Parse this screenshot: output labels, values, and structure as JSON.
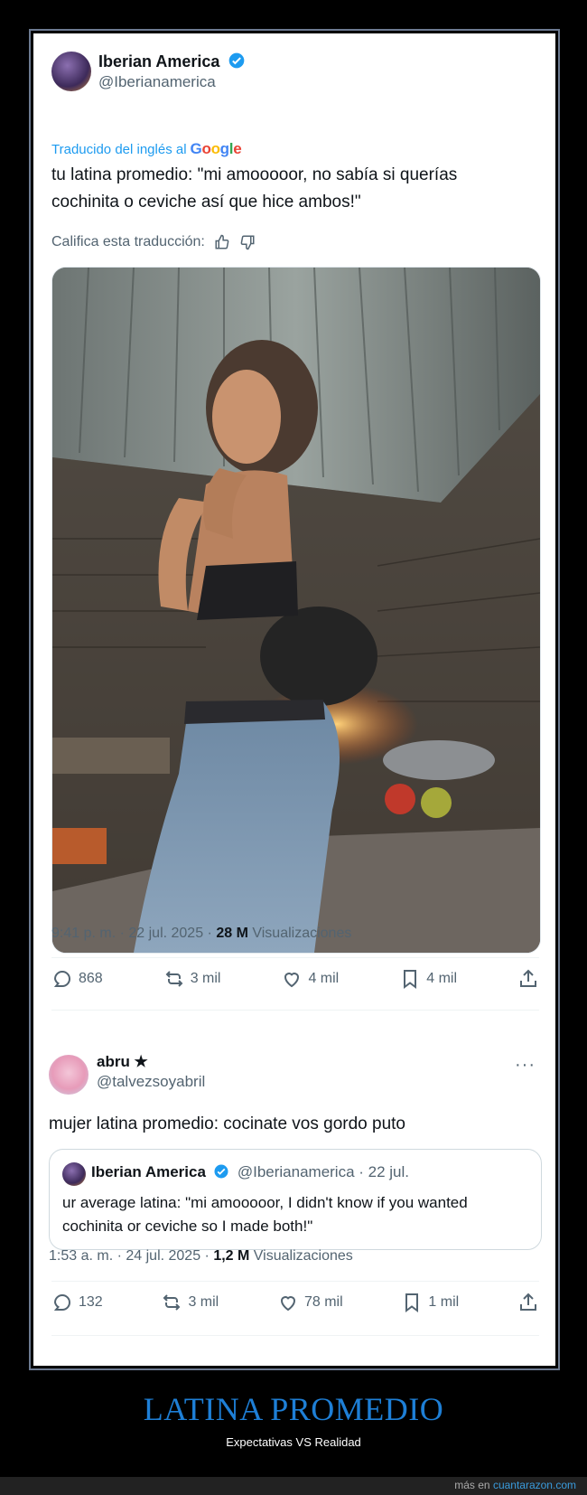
{
  "tweet1": {
    "name": "Iberian America",
    "handle": "@Iberianamerica",
    "translated_prefix": "Traducido del inglés al",
    "translated_brand": "Google",
    "text_line1": "tu latina promedio: \"mi amooooor, no sabía si querías",
    "text_line2": "cochinita o ceviche así que hice ambos!\"",
    "rate_label": "Califica esta traducción:",
    "time": "9:41 p. m. · 22 jul. 2025 · ",
    "views_count": "28 M",
    "views_label": " Visualizaciones",
    "replies": "868",
    "reposts": "3 mil",
    "likes": "4 mil",
    "bookmarks": "4 mil"
  },
  "tweet2": {
    "name": "abru ★",
    "handle": "@talvezsoyabril",
    "more": "···",
    "text": "mujer latina promedio: cocinate vos gordo puto",
    "quote": {
      "name": "Iberian America",
      "handle_date": "@Iberianamerica · 22 jul.",
      "text_line1": "ur average latina: \"mi amooooor, I didn't know if you wanted",
      "text_line2": "cochinita or ceviche so I made both!\""
    },
    "time": "1:53 a. m. · 24 jul. 2025 · ",
    "views_count": "1,2 M",
    "views_label": " Visualizaciones",
    "replies": "132",
    "reposts": "3 mil",
    "likes": "78 mil",
    "bookmarks": "1 mil"
  },
  "footer": {
    "title": "LATINA PROMEDIO",
    "subtitle": "Expectativas VS Realidad",
    "credit_prefix": "más en ",
    "credit_site": "cuantarazon.com"
  },
  "colors": {
    "accent": "#1d9bf0",
    "footer_title": "#1e7fd6",
    "verified": "#1d9bf0"
  },
  "icons": [
    "verified-badge-icon",
    "thumbs-up-icon",
    "thumbs-down-icon",
    "reply-icon",
    "repost-icon",
    "like-icon",
    "bookmark-icon",
    "share-icon",
    "more-icon"
  ]
}
